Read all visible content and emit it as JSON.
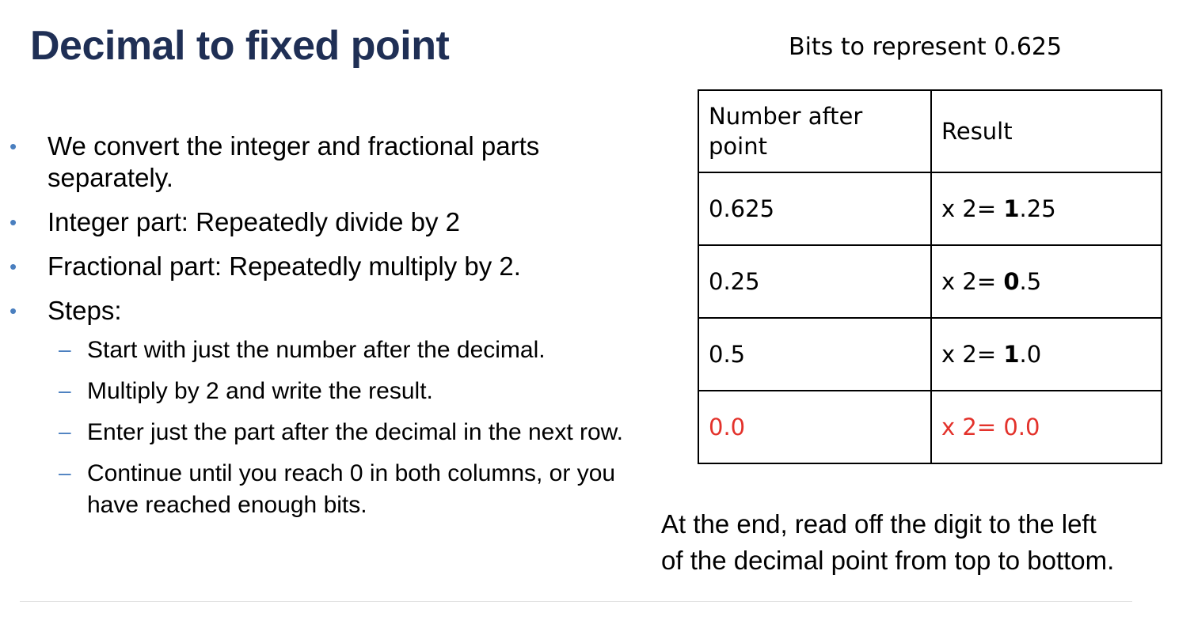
{
  "slide": {
    "title": "Decimal to fixed point",
    "bullets": [
      {
        "text": "We convert the integer and fractional parts separately."
      },
      {
        "text": "Integer part: Repeatedly divide by 2"
      },
      {
        "text": "Fractional part: Repeatedly multiply by 2."
      },
      {
        "text": "Steps:"
      }
    ],
    "sub_bullets": [
      "Start with just the number after the decimal.",
      "Multiply by 2 and write the result.",
      "Enter just the part after the decimal in the next row.",
      "Continue until you reach 0 in both columns, or you have reached enough bits."
    ],
    "bullet_marker": "•",
    "sub_marker": "–"
  },
  "table": {
    "caption": "Bits to represent 0.625",
    "headers": [
      "Number after point",
      "Result"
    ],
    "rows": [
      {
        "number": "0.625",
        "result_prefix": "x 2= ",
        "result_bold": "1",
        "result_suffix": ".25"
      },
      {
        "number": "0.25",
        "result_prefix": "x 2= ",
        "result_bold": "0",
        "result_suffix": ".5"
      },
      {
        "number": "0.5",
        "result_prefix": "x 2= ",
        "result_bold": "1",
        "result_suffix": ".0"
      },
      {
        "number": "0.0",
        "result_prefix": "x 2= ",
        "result_bold": "",
        "result_suffix": "0.0"
      }
    ],
    "highlight_color": "#e3322b"
  },
  "conclusion": {
    "line1": "At the end, read off the digit to the left",
    "line2": "of the decimal point from top to bottom."
  },
  "colors": {
    "title": "#1f2f55",
    "bullet_marker": "#4a7fbf"
  }
}
